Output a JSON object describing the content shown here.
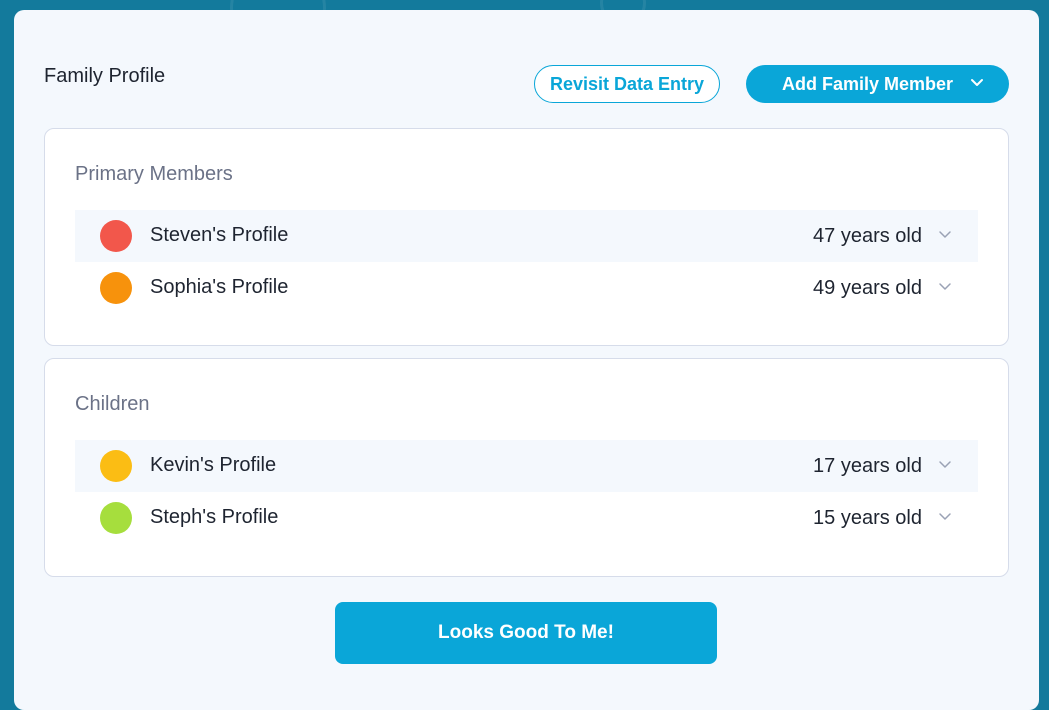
{
  "header": {
    "title": "Family Profile",
    "revisit_label": "Revisit Data Entry",
    "add_member_label": "Add Family Member",
    "add_member_icon": "chevron-down-icon"
  },
  "sections": [
    {
      "title": "Primary Members",
      "members": [
        {
          "name": "Steven's Profile",
          "age": "47 years old",
          "color": "#f2574b"
        },
        {
          "name": "Sophia's Profile",
          "age": "49 years old",
          "color": "#f7920c"
        }
      ]
    },
    {
      "title": "Children",
      "members": [
        {
          "name": "Kevin's Profile",
          "age": "17 years old",
          "color": "#fbbd14"
        },
        {
          "name": "Steph's Profile",
          "age": "15 years old",
          "color": "#a6de3d"
        }
      ]
    }
  ],
  "footer": {
    "confirm_label": "Looks Good To Me!"
  },
  "colors": {
    "accent": "#0aa6d8",
    "background": "#137a9c",
    "panel": "#f4f8fd"
  }
}
